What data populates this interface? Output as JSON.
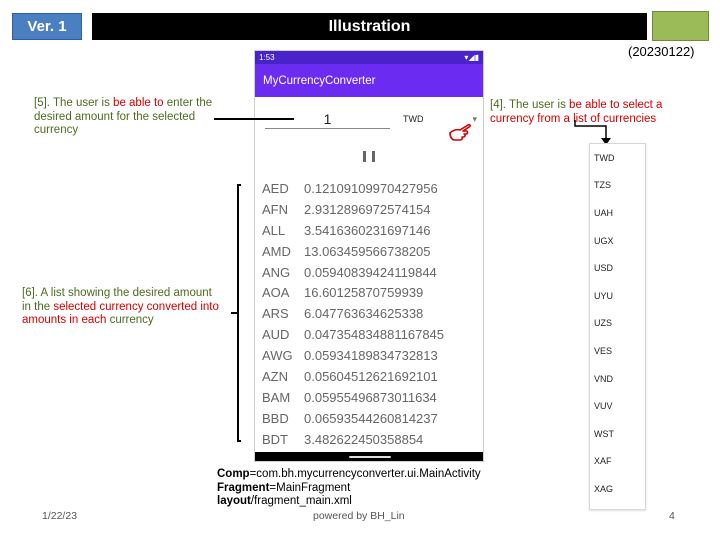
{
  "header": {
    "version_label": "Ver. 1",
    "title": "Illustration",
    "date_code": "(20230122)"
  },
  "phone": {
    "status_time": "1:53",
    "status_icons": "▾◢▮",
    "app_title": "MyCurrencyConverter",
    "amount_value": "1",
    "selected_currency": "TWD",
    "rates": [
      {
        "code": "AED",
        "value": "0.12109109970427956"
      },
      {
        "code": "AFN",
        "value": "2.9312896972574154"
      },
      {
        "code": "ALL",
        "value": "3.5416360231697146"
      },
      {
        "code": "AMD",
        "value": "13.063459566738205"
      },
      {
        "code": "ANG",
        "value": "0.05940839424119844"
      },
      {
        "code": "AOA",
        "value": "16.60125870759939"
      },
      {
        "code": "ARS",
        "value": "6.047763634625338"
      },
      {
        "code": "AUD",
        "value": "0.047354834881167845"
      },
      {
        "code": "AWG",
        "value": "0.05934189834732813"
      },
      {
        "code": "AZN",
        "value": "0.05604512621692101"
      },
      {
        "code": "BAM",
        "value": "0.05955496873011634"
      },
      {
        "code": "BBD",
        "value": "0.06593544260814237"
      },
      {
        "code": "BDT",
        "value": "3.482622450358854"
      }
    ]
  },
  "annotations": {
    "note5": {
      "pre": "[5]. The user is ",
      "red": "be able to",
      "post": " enter the desired amount for the selected currency"
    },
    "note4": {
      "pre": "[4]. The user is ",
      "red": "be able to select a currency from a list of currencies",
      "post": ""
    },
    "note6": {
      "pre": "[6]. A list showing the desired amount in the ",
      "red": "selected currency converted into amounts in each",
      "post": " currency"
    }
  },
  "dropdown": {
    "items": [
      "TWD",
      "TZS",
      "UAH",
      "UGX",
      "USD",
      "UYU",
      "UZS",
      "VES",
      "VND",
      "VUV",
      "WST",
      "XAF",
      "XAG"
    ]
  },
  "source": {
    "comp_label": "Comp",
    "comp_value": "=com.bh.mycurrencyconverter.ui.MainActivity",
    "fragment_label": "Fragment",
    "fragment_value": "=MainFragment",
    "layout_label": "layout",
    "layout_value": "/fragment_main.xml"
  },
  "footer": {
    "date": "1/22/23",
    "credit": "powered by BH_Lin",
    "page": "4"
  },
  "colors": {
    "appbar": "#6c2bf0",
    "statusbar": "#4a22c9",
    "note_green": "#4d6b1f",
    "note_red": "#d40000",
    "version_badge": "#4a7fc1",
    "accent_box": "#9bbb59"
  }
}
